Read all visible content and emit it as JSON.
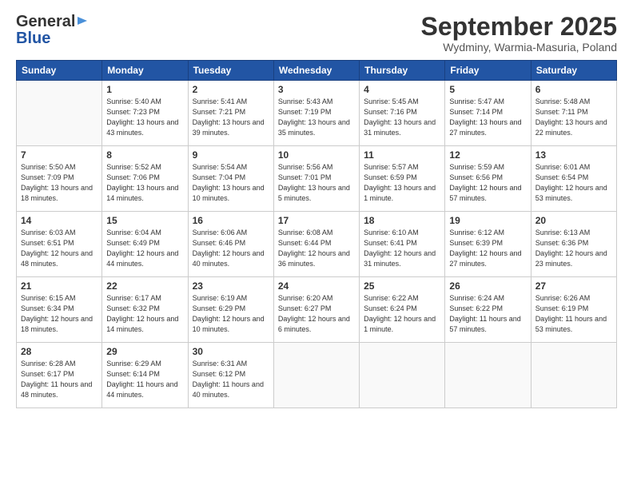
{
  "header": {
    "logo_line1": "General",
    "logo_line2": "Blue",
    "month_title": "September 2025",
    "location": "Wydminy, Warmia-Masuria, Poland"
  },
  "days_of_week": [
    "Sunday",
    "Monday",
    "Tuesday",
    "Wednesday",
    "Thursday",
    "Friday",
    "Saturday"
  ],
  "weeks": [
    [
      {
        "day": "",
        "empty": true
      },
      {
        "day": "1",
        "sunrise": "5:40 AM",
        "sunset": "7:23 PM",
        "daylight": "13 hours and 43 minutes."
      },
      {
        "day": "2",
        "sunrise": "5:41 AM",
        "sunset": "7:21 PM",
        "daylight": "13 hours and 39 minutes."
      },
      {
        "day": "3",
        "sunrise": "5:43 AM",
        "sunset": "7:19 PM",
        "daylight": "13 hours and 35 minutes."
      },
      {
        "day": "4",
        "sunrise": "5:45 AM",
        "sunset": "7:16 PM",
        "daylight": "13 hours and 31 minutes."
      },
      {
        "day": "5",
        "sunrise": "5:47 AM",
        "sunset": "7:14 PM",
        "daylight": "13 hours and 27 minutes."
      },
      {
        "day": "6",
        "sunrise": "5:48 AM",
        "sunset": "7:11 PM",
        "daylight": "13 hours and 22 minutes."
      }
    ],
    [
      {
        "day": "7",
        "sunrise": "5:50 AM",
        "sunset": "7:09 PM",
        "daylight": "13 hours and 18 minutes."
      },
      {
        "day": "8",
        "sunrise": "5:52 AM",
        "sunset": "7:06 PM",
        "daylight": "13 hours and 14 minutes."
      },
      {
        "day": "9",
        "sunrise": "5:54 AM",
        "sunset": "7:04 PM",
        "daylight": "13 hours and 10 minutes."
      },
      {
        "day": "10",
        "sunrise": "5:56 AM",
        "sunset": "7:01 PM",
        "daylight": "13 hours and 5 minutes."
      },
      {
        "day": "11",
        "sunrise": "5:57 AM",
        "sunset": "6:59 PM",
        "daylight": "13 hours and 1 minute."
      },
      {
        "day": "12",
        "sunrise": "5:59 AM",
        "sunset": "6:56 PM",
        "daylight": "12 hours and 57 minutes."
      },
      {
        "day": "13",
        "sunrise": "6:01 AM",
        "sunset": "6:54 PM",
        "daylight": "12 hours and 53 minutes."
      }
    ],
    [
      {
        "day": "14",
        "sunrise": "6:03 AM",
        "sunset": "6:51 PM",
        "daylight": "12 hours and 48 minutes."
      },
      {
        "day": "15",
        "sunrise": "6:04 AM",
        "sunset": "6:49 PM",
        "daylight": "12 hours and 44 minutes."
      },
      {
        "day": "16",
        "sunrise": "6:06 AM",
        "sunset": "6:46 PM",
        "daylight": "12 hours and 40 minutes."
      },
      {
        "day": "17",
        "sunrise": "6:08 AM",
        "sunset": "6:44 PM",
        "daylight": "12 hours and 36 minutes."
      },
      {
        "day": "18",
        "sunrise": "6:10 AM",
        "sunset": "6:41 PM",
        "daylight": "12 hours and 31 minutes."
      },
      {
        "day": "19",
        "sunrise": "6:12 AM",
        "sunset": "6:39 PM",
        "daylight": "12 hours and 27 minutes."
      },
      {
        "day": "20",
        "sunrise": "6:13 AM",
        "sunset": "6:36 PM",
        "daylight": "12 hours and 23 minutes."
      }
    ],
    [
      {
        "day": "21",
        "sunrise": "6:15 AM",
        "sunset": "6:34 PM",
        "daylight": "12 hours and 18 minutes."
      },
      {
        "day": "22",
        "sunrise": "6:17 AM",
        "sunset": "6:32 PM",
        "daylight": "12 hours and 14 minutes."
      },
      {
        "day": "23",
        "sunrise": "6:19 AM",
        "sunset": "6:29 PM",
        "daylight": "12 hours and 10 minutes."
      },
      {
        "day": "24",
        "sunrise": "6:20 AM",
        "sunset": "6:27 PM",
        "daylight": "12 hours and 6 minutes."
      },
      {
        "day": "25",
        "sunrise": "6:22 AM",
        "sunset": "6:24 PM",
        "daylight": "12 hours and 1 minute."
      },
      {
        "day": "26",
        "sunrise": "6:24 AM",
        "sunset": "6:22 PM",
        "daylight": "11 hours and 57 minutes."
      },
      {
        "day": "27",
        "sunrise": "6:26 AM",
        "sunset": "6:19 PM",
        "daylight": "11 hours and 53 minutes."
      }
    ],
    [
      {
        "day": "28",
        "sunrise": "6:28 AM",
        "sunset": "6:17 PM",
        "daylight": "11 hours and 48 minutes."
      },
      {
        "day": "29",
        "sunrise": "6:29 AM",
        "sunset": "6:14 PM",
        "daylight": "11 hours and 44 minutes."
      },
      {
        "day": "30",
        "sunrise": "6:31 AM",
        "sunset": "6:12 PM",
        "daylight": "11 hours and 40 minutes."
      },
      {
        "day": "",
        "empty": true
      },
      {
        "day": "",
        "empty": true
      },
      {
        "day": "",
        "empty": true
      },
      {
        "day": "",
        "empty": true
      }
    ]
  ]
}
